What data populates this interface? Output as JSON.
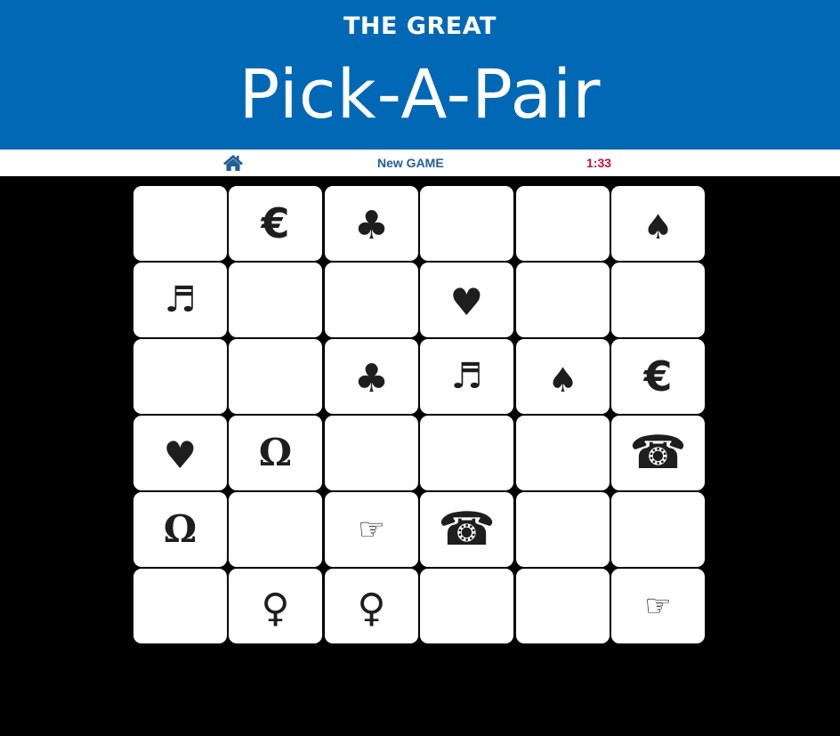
{
  "header": {
    "subtitle": "THE GREAT",
    "title": "Pick-A-Pair"
  },
  "nav": {
    "home_icon": "home-icon",
    "new_game_label": "New GAME",
    "timer": "1:33"
  },
  "colors": {
    "banner": "#0068b4",
    "nav_link": "#1f5f95",
    "timer": "#c8102e",
    "board_background": "#000000",
    "card_face": "#ffffff",
    "symbol": "#1e1e1e"
  },
  "board": {
    "rows": 6,
    "cols": 6,
    "cards": [
      {
        "row": 0,
        "col": 0,
        "symbol": "",
        "icon": ""
      },
      {
        "row": 0,
        "col": 1,
        "symbol": "€",
        "icon": "euro-icon"
      },
      {
        "row": 0,
        "col": 2,
        "symbol": "♣",
        "icon": "club-icon"
      },
      {
        "row": 0,
        "col": 3,
        "symbol": "",
        "icon": ""
      },
      {
        "row": 0,
        "col": 4,
        "symbol": "",
        "icon": ""
      },
      {
        "row": 0,
        "col": 5,
        "symbol": "♠",
        "icon": "spade-icon"
      },
      {
        "row": 1,
        "col": 0,
        "symbol": "♬",
        "icon": "music-note-icon"
      },
      {
        "row": 1,
        "col": 1,
        "symbol": "",
        "icon": ""
      },
      {
        "row": 1,
        "col": 2,
        "symbol": "",
        "icon": ""
      },
      {
        "row": 1,
        "col": 3,
        "symbol": "♥",
        "icon": "heart-icon"
      },
      {
        "row": 1,
        "col": 4,
        "symbol": "",
        "icon": ""
      },
      {
        "row": 1,
        "col": 5,
        "symbol": "",
        "icon": ""
      },
      {
        "row": 2,
        "col": 0,
        "symbol": "",
        "icon": ""
      },
      {
        "row": 2,
        "col": 1,
        "symbol": "",
        "icon": ""
      },
      {
        "row": 2,
        "col": 2,
        "symbol": "♣",
        "icon": "club-icon"
      },
      {
        "row": 2,
        "col": 3,
        "symbol": "♬",
        "icon": "music-note-icon"
      },
      {
        "row": 2,
        "col": 4,
        "symbol": "♠",
        "icon": "spade-icon"
      },
      {
        "row": 2,
        "col": 5,
        "symbol": "€",
        "icon": "euro-icon"
      },
      {
        "row": 3,
        "col": 0,
        "symbol": "♥",
        "icon": "heart-icon"
      },
      {
        "row": 3,
        "col": 1,
        "symbol": "Ω",
        "icon": "omega-icon"
      },
      {
        "row": 3,
        "col": 2,
        "symbol": "",
        "icon": ""
      },
      {
        "row": 3,
        "col": 3,
        "symbol": "",
        "icon": ""
      },
      {
        "row": 3,
        "col": 4,
        "symbol": "",
        "icon": ""
      },
      {
        "row": 3,
        "col": 5,
        "symbol": "☎",
        "icon": "telephone-icon"
      },
      {
        "row": 4,
        "col": 0,
        "symbol": "Ω",
        "icon": "omega-icon"
      },
      {
        "row": 4,
        "col": 1,
        "symbol": "",
        "icon": ""
      },
      {
        "row": 4,
        "col": 2,
        "symbol": "☞",
        "icon": "pointing-hand-icon"
      },
      {
        "row": 4,
        "col": 3,
        "symbol": "☎",
        "icon": "telephone-icon"
      },
      {
        "row": 4,
        "col": 4,
        "symbol": "",
        "icon": ""
      },
      {
        "row": 4,
        "col": 5,
        "symbol": "",
        "icon": ""
      },
      {
        "row": 5,
        "col": 0,
        "symbol": "",
        "icon": ""
      },
      {
        "row": 5,
        "col": 1,
        "symbol": "♀",
        "icon": "female-sign-icon"
      },
      {
        "row": 5,
        "col": 2,
        "symbol": "♀",
        "icon": "female-sign-icon"
      },
      {
        "row": 5,
        "col": 3,
        "symbol": "",
        "icon": ""
      },
      {
        "row": 5,
        "col": 4,
        "symbol": "",
        "icon": ""
      },
      {
        "row": 5,
        "col": 5,
        "symbol": "☞",
        "icon": "pointing-hand-icon"
      }
    ]
  }
}
